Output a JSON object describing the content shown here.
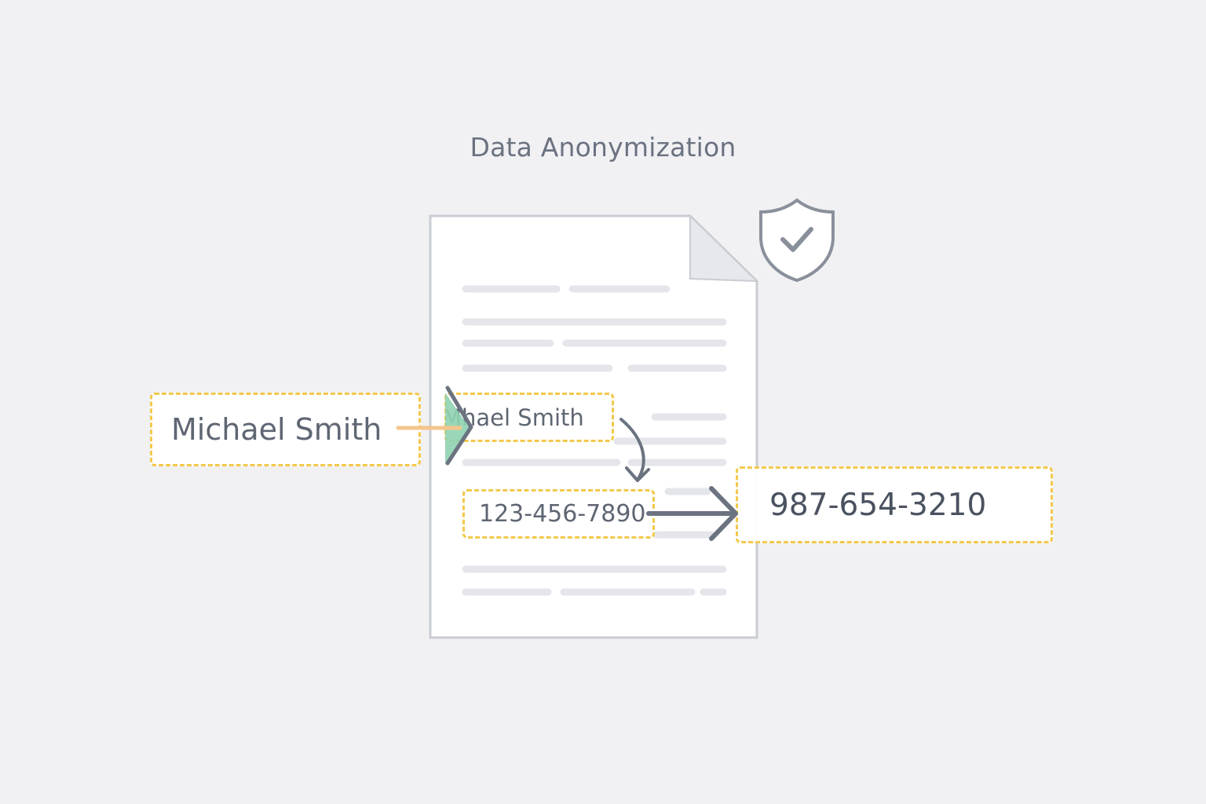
{
  "title": "Data Anonymization",
  "labels": {
    "source_name": "Michael Smith",
    "masked_name": "Mhael Smith",
    "original_phone": "123-456-7890",
    "replacement_phone": "987-654-3210"
  },
  "colors": {
    "background": "#f1f1f4",
    "highlight_border": "#f2c94c",
    "name_arrow": "#f4c58b",
    "mask_accent": "#8fd3b1",
    "arrow": "#6b7280",
    "document_border": "#c9ccd3",
    "text_lines": "#e5e6eb"
  },
  "icons": [
    "document-icon",
    "shield-check-icon",
    "arrow-icon"
  ]
}
